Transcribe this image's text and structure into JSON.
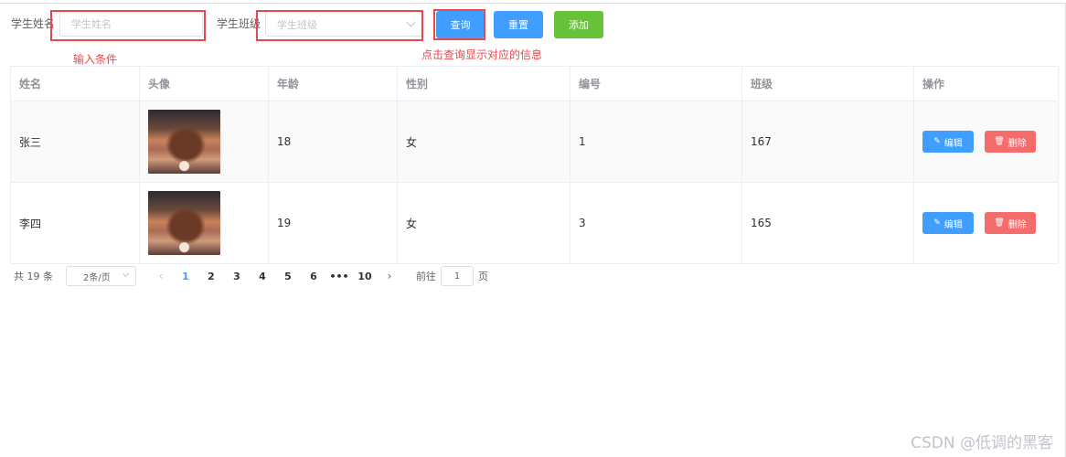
{
  "search": {
    "name_label": "学生姓名",
    "name_placeholder": "学生姓名",
    "class_label": "学生班级",
    "class_placeholder": "学生班级",
    "query_button": "查询",
    "reset_button": "重置",
    "add_button": "添加"
  },
  "annotations": {
    "input_hint": "输入条件",
    "query_hint": "点击查询显示对应的信息"
  },
  "table": {
    "columns": [
      "姓名",
      "头像",
      "年龄",
      "性别",
      "编号",
      "班级",
      "操作"
    ],
    "rows": [
      {
        "name": "张三",
        "age": "18",
        "gender": "女",
        "id": "1",
        "class": "167"
      },
      {
        "name": "李四",
        "age": "19",
        "gender": "女",
        "id": "3",
        "class": "165"
      }
    ],
    "edit_label": "编辑",
    "delete_label": "删除"
  },
  "pagination": {
    "total": "共 19 条",
    "page_size": "2条/页",
    "pages": [
      "1",
      "2",
      "3",
      "4",
      "5",
      "6",
      "•••",
      "10"
    ],
    "current_page": "1",
    "goto_prefix": "前往",
    "goto_value": "1",
    "goto_suffix": "页"
  },
  "watermark": "CSDN @低调的黑客",
  "colors": {
    "primary": "#409eff",
    "success": "#67c23a",
    "danger": "#f56c6c",
    "annotation": "#e8474d"
  }
}
